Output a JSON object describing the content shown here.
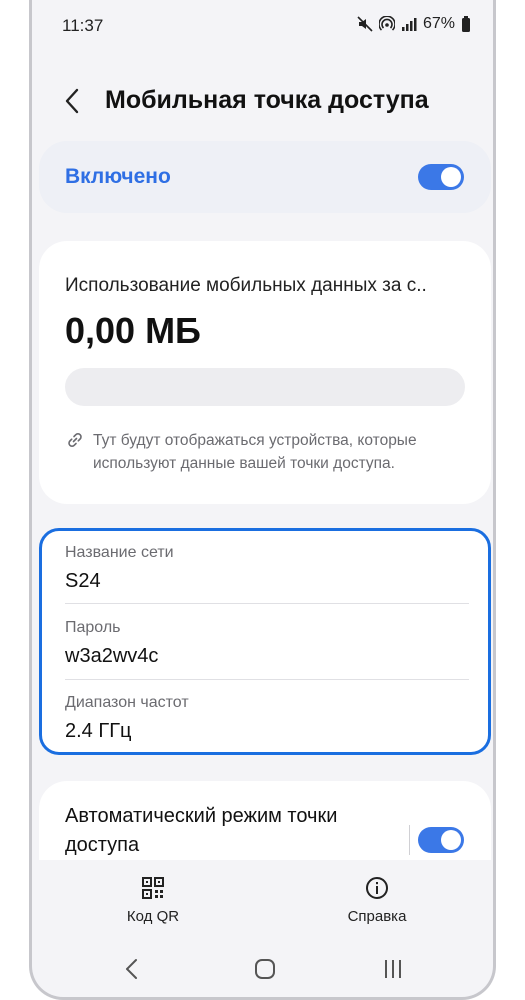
{
  "status_bar": {
    "time": "11:37",
    "battery": "67%"
  },
  "header": {
    "title": "Мобильная точка доступа"
  },
  "hotspot_switch": {
    "label": "Включено",
    "enabled": true
  },
  "usage": {
    "label": "Использование мобильных данных за с..",
    "value": "0,00 МБ",
    "note": "Тут будут отображаться устройства, которые используют данные вашей точки доступа."
  },
  "network": {
    "name_label": "Название сети",
    "name_value": "S24",
    "password_label": "Пароль",
    "password_value": "w3a2wv4c",
    "band_label": "Диапазон частот",
    "band_value": "2.4 ГГц"
  },
  "auto_hotspot": {
    "label": "Автоматический режим точки доступа",
    "enabled": true
  },
  "bottom_actions": {
    "qr_label": "Код QR",
    "help_label": "Справка"
  },
  "colors": {
    "accent": "#3b78e7",
    "highlight_border": "#1a6ee0",
    "background": "#f4f4f7"
  }
}
